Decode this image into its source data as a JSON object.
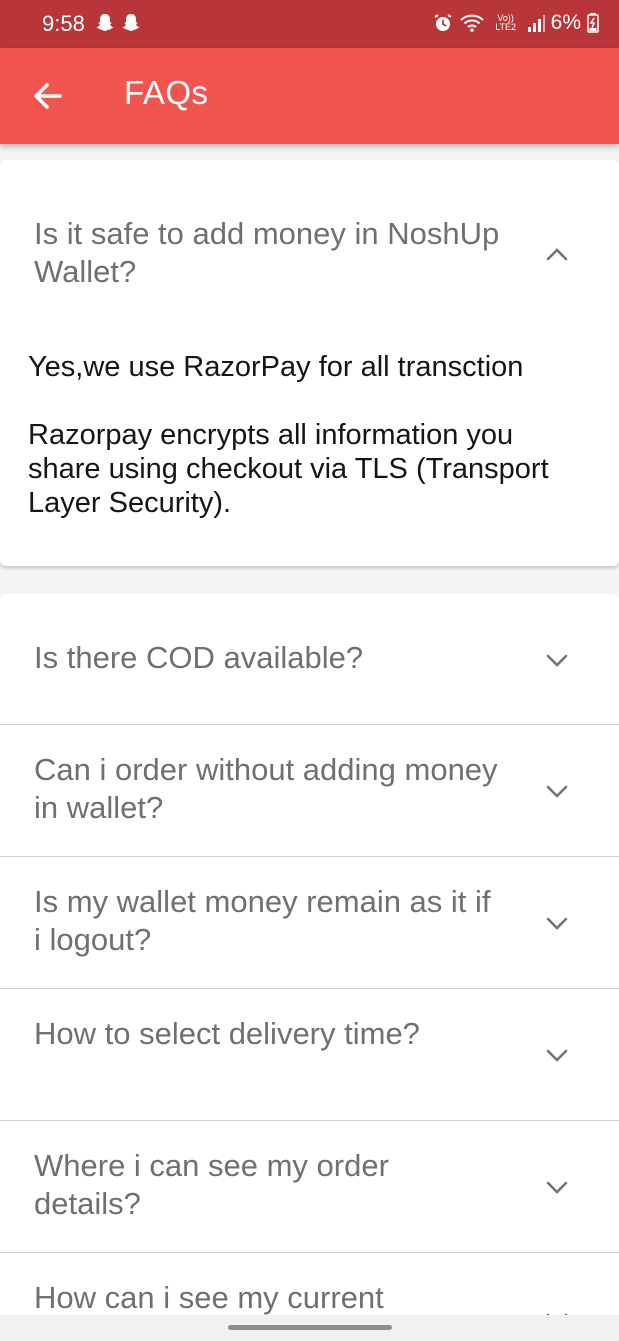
{
  "status_bar": {
    "time": "9:58",
    "battery": "6%",
    "network": "Vo)) LTE2",
    "icons": [
      "snapchat-ghost-icon",
      "snapchat-ghost-icon",
      "alarm-icon",
      "wifi-icon",
      "signal-icon",
      "battery-charging-icon"
    ]
  },
  "app_bar": {
    "title": "FAQs",
    "back_icon": "arrow-left-icon",
    "color": "#f25450"
  },
  "faq_expanded": {
    "question": "Is it safe to add money in NoshUp Wallet?",
    "answer_paragraphs": [
      "Yes,we use RazorPay for all transction",
      "Razorpay encrypts all information you share using checkout via TLS (Transport Layer Security)."
    ],
    "icon": "chevron-up-icon"
  },
  "faq_items": [
    {
      "question": "Is there COD available?",
      "icon": "chevron-down-icon"
    },
    {
      "question": "Can i order without adding money in wallet?",
      "icon": "chevron-down-icon"
    },
    {
      "question": "Is my wallet money remain as it if i logout?",
      "icon": "chevron-down-icon"
    },
    {
      "question": "How to select delivery time?",
      "icon": "chevron-down-icon"
    },
    {
      "question": "Where i can see my order details?",
      "icon": "chevron-down-icon"
    },
    {
      "question": "How can i see my current",
      "icon": "chevron-down-icon"
    }
  ]
}
